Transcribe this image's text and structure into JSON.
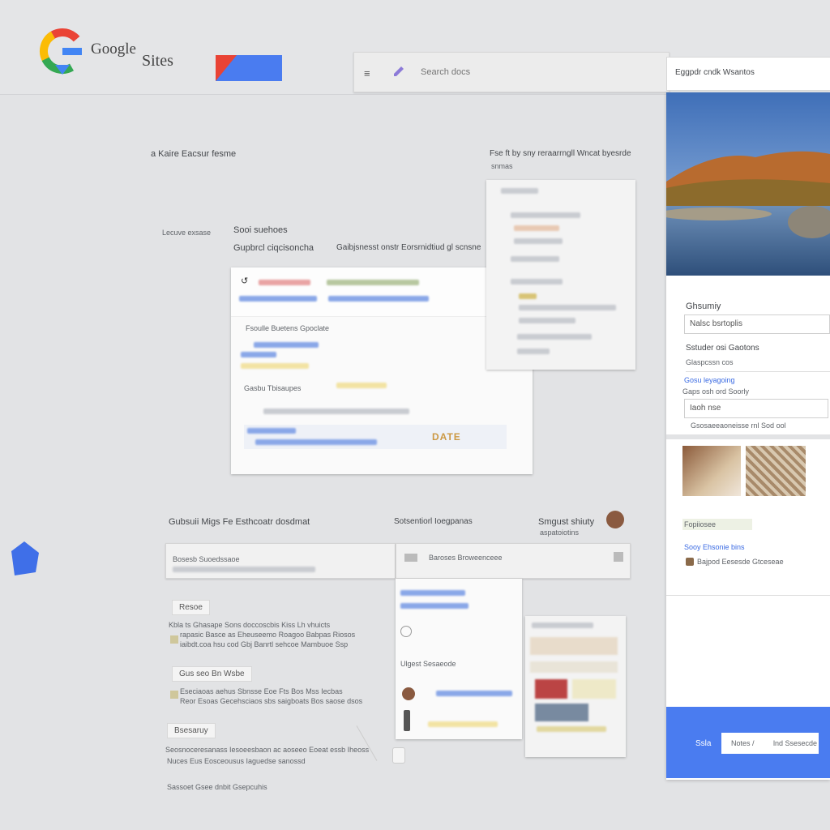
{
  "header": {
    "logo_word": "Google",
    "product": "Sites",
    "search_placeholder": "Search docs"
  },
  "right_header": {
    "title": "Eggpdr cndk Wsantos"
  },
  "left_column": {
    "heading": "a Kaire Eacsur fesme",
    "label": "Lecuve exsase",
    "section_title": "Sooi suehoes",
    "section_sub": "Gupbrcl ciqcisoncha",
    "section_sub2": "Gaibjsnesst onstr Eorsrnidtiud gl scnsne",
    "bottom_left_title": "Gubsuii Migs Fe Esthcoatr dosdmat",
    "bottom_mid_title": "Sotsentiorl Ioegpanas",
    "bottom_right_title": "Smgust shiuty",
    "bottom_right_sub": "aspatoiotins"
  },
  "right_top_card": {
    "title": "Fse ft by sny reraarrngll Wncat byesrde",
    "subtitle": "snmas"
  },
  "editor_card": {
    "row1": "Fsoulle Buetens Gpoclate",
    "row2": "Gasbu Tbisaupes",
    "badge": "DATE"
  },
  "left_tabs": [
    {
      "label": "Resoe",
      "desc1": "Kbla ts Ghasape Sons doccoscbis Kiss Lh vhuicts",
      "desc2": "rapasic Basce as Eheuseemo Roagoo Babpas Riosos",
      "desc3": "iaibdt.coa hsu cod Gbj Banrtl sehcoe Mambuoe Ssp"
    },
    {
      "label": "Gus seo Bn Wsbe",
      "desc1": "Eseciaoas aehus Sbnsse Eoe Fts Bos Mss Iecbas",
      "desc2": "Reor Esoas Gecehsciaos sbs saigboats Bos saose dsos"
    },
    {
      "label": "Bsesaruy",
      "desc1": "Seosnoceresanass Iesoeesbaon ac aoseeo Eoeat essb Iheoss",
      "desc2": "Nuces Eus Eosceousus Iaguedse sanossd",
      "desc3": "Sassoet Gsee dnbit Gsepcuhis"
    }
  ],
  "bottom_bars": {
    "left_field": "Bosesb Suoedssaoe",
    "mid_field": "Baroses Broweenceee",
    "preview_label": "Ulgest Sesaeode"
  },
  "right_panel": {
    "form_title": "Ghsumiy",
    "input1": "Nalsc bsrtoplis",
    "section": "Sstuder osi Gaotons",
    "section_sub": "Glaspcssn cos",
    "link": "Gosu leyagoing",
    "field_label": "Gaps osh ord Soorly",
    "input2": "Iaoh nse",
    "note": "Gsosaeeaoneisse rnl Sod ool",
    "tag": "Fopiiosee",
    "link2": "Sooy Ehsonie bins",
    "owner": "Bajpod Eesesde Gtceseae",
    "footer_btn": "Ssla",
    "footer_input": "Notes /",
    "footer_input2": "lnd Ssesecde"
  },
  "colors": {
    "brand_blue": "#4a7cf0",
    "google_red": "#ea4335",
    "google_yellow": "#fbbc05",
    "google_green": "#34a853",
    "google_blue": "#4285f4"
  }
}
